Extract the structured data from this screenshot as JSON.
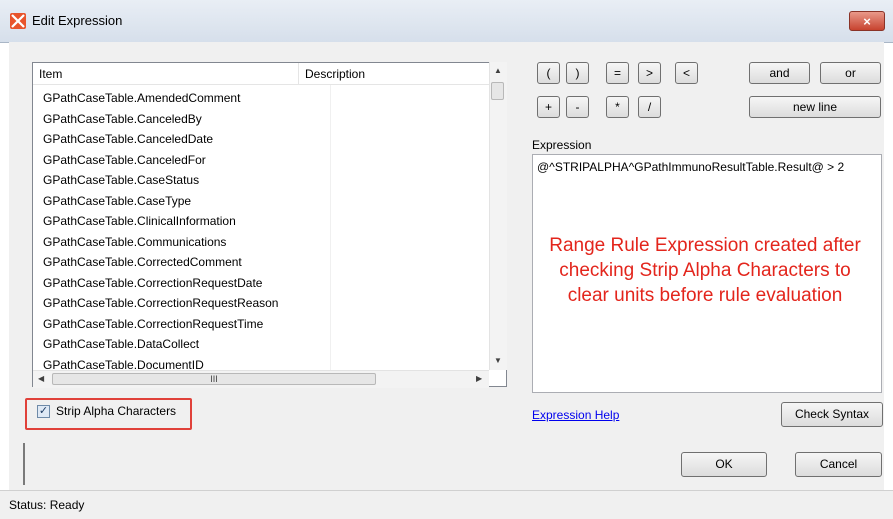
{
  "window": {
    "title": "Edit Expression",
    "close_glyph": "×"
  },
  "list": {
    "columns": [
      "Item",
      "Description"
    ],
    "rows": [
      "GPathCaseTable.AmendedComment",
      "GPathCaseTable.CanceledBy",
      "GPathCaseTable.CanceledDate",
      "GPathCaseTable.CanceledFor",
      "GPathCaseTable.CaseStatus",
      "GPathCaseTable.CaseType",
      "GPathCaseTable.ClinicalInformation",
      "GPathCaseTable.Communications",
      "GPathCaseTable.CorrectedComment",
      "GPathCaseTable.CorrectionRequestDate",
      "GPathCaseTable.CorrectionRequestReason",
      "GPathCaseTable.CorrectionRequestTime",
      "GPathCaseTable.DataCollect",
      "GPathCaseTable.DocumentID"
    ],
    "hscroll_grip": "III"
  },
  "operators": {
    "row1": [
      "(",
      ")",
      "=",
      ">",
      "<"
    ],
    "row2": [
      "+",
      "-",
      "*",
      "/"
    ],
    "and": "and",
    "or": "or",
    "new_line": "new line"
  },
  "expression": {
    "label": "Expression",
    "value": "@^STRIPALPHA^GPathImmunoResultTable.Result@ > 2"
  },
  "annotation": "Range Rule Expression created after checking Strip Alpha Characters to clear units before rule evaluation",
  "strip_alpha": {
    "label": "Strip Alpha Characters",
    "checked": true,
    "check_glyph": "✓"
  },
  "links": {
    "expression_help": "Expression Help"
  },
  "buttons": {
    "check_syntax": "Check Syntax",
    "ok": "OK",
    "cancel": "Cancel"
  },
  "status": {
    "text": "Status: Ready"
  },
  "colors": {
    "annotation": "#e3251c",
    "highlight_border": "#e0413a",
    "link": "#0000ee"
  },
  "icons": {
    "app": "app-logo-icon",
    "close": "close-icon"
  }
}
